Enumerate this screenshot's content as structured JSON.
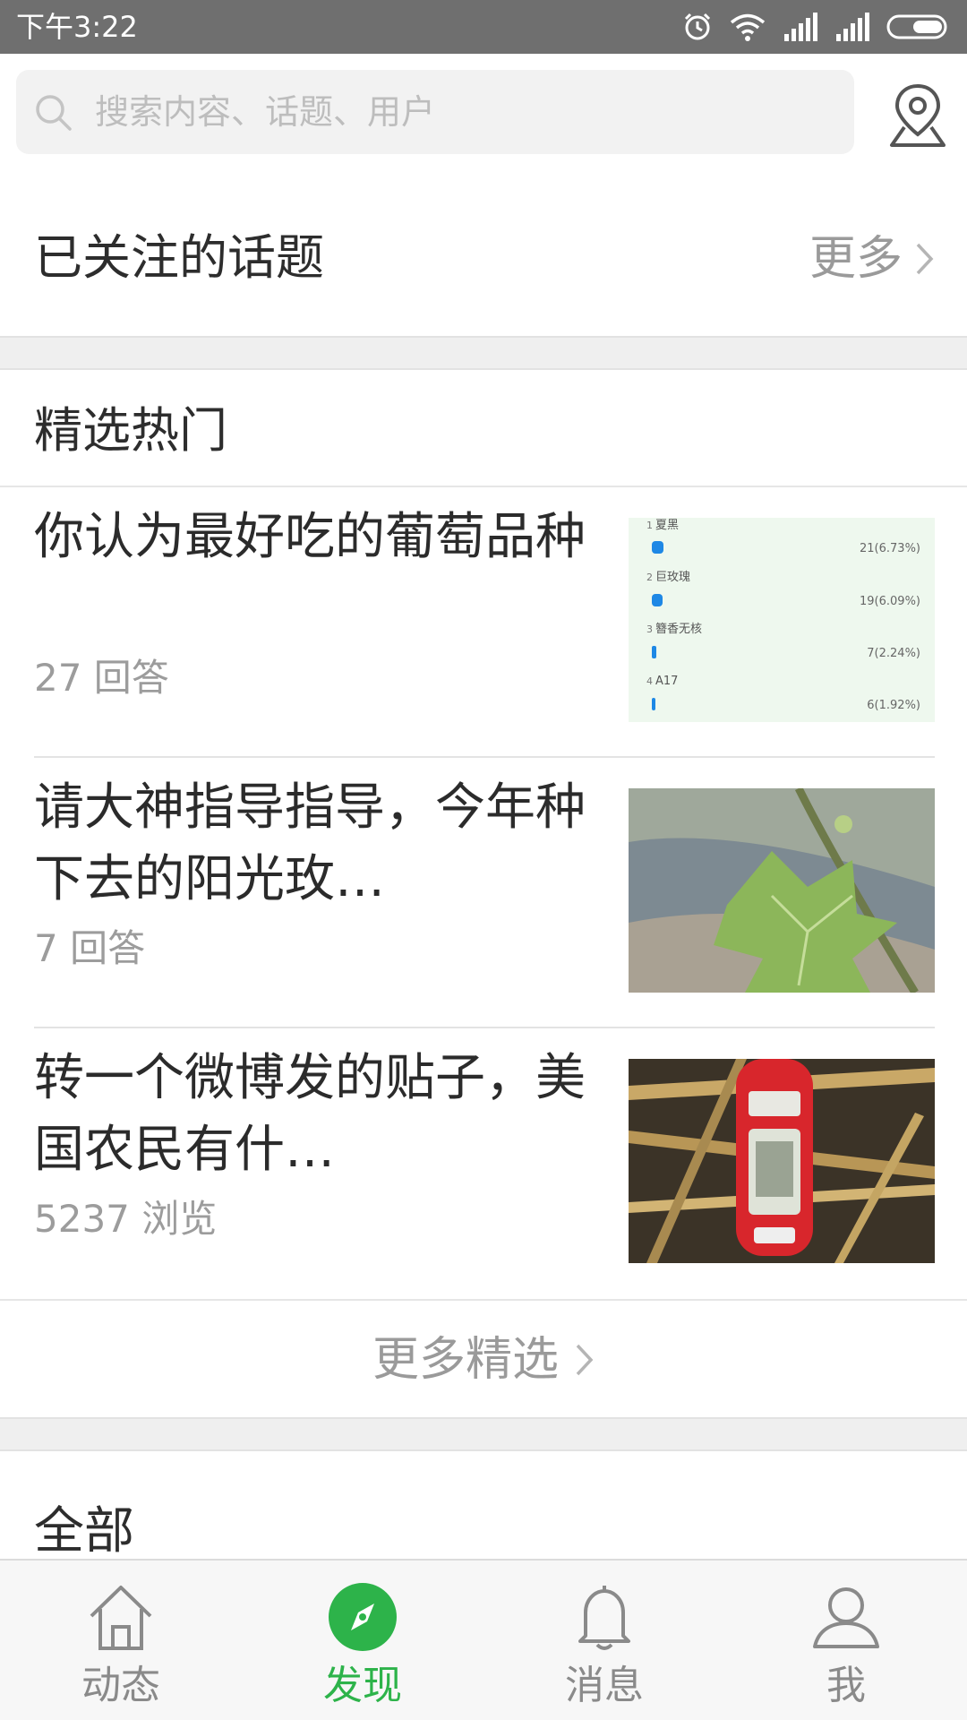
{
  "status_bar": {
    "time": "下午3:22"
  },
  "search": {
    "placeholder": "搜索内容、话题、用户"
  },
  "followed_topics": {
    "title": "已关注的话题",
    "more_label": "更多"
  },
  "picks": {
    "title": "精选热门",
    "posts": [
      {
        "title": "你认为最好吃的葡萄品种",
        "meta": "27 回答",
        "poll": [
          {
            "rank": "1",
            "name": "夏黑",
            "result": "21(6.73%)",
            "percent": 6.73
          },
          {
            "rank": "2",
            "name": "巨玫瑰",
            "result": "19(6.09%)",
            "percent": 6.09
          },
          {
            "rank": "3",
            "name": "簪香无核",
            "result": "7(2.24%)",
            "percent": 2.24
          },
          {
            "rank": "4",
            "name": "A17",
            "result": "6(1.92%)",
            "percent": 1.92
          }
        ]
      },
      {
        "title": "请大神指导指导，今年种下去的阳光玫…",
        "meta": "7 回答"
      },
      {
        "title": "转一个微博发的贴子，美国农民有什…",
        "meta": "5237 浏览"
      }
    ],
    "more_label": "更多精选"
  },
  "all_section": {
    "title": "全部"
  },
  "tab_bar": {
    "tabs": [
      {
        "label": "动态",
        "icon": "home-icon",
        "active": false
      },
      {
        "label": "发现",
        "icon": "compass-icon",
        "active": true
      },
      {
        "label": "消息",
        "icon": "bell-icon",
        "active": false
      },
      {
        "label": "我",
        "icon": "person-icon",
        "active": false
      }
    ]
  },
  "colors": {
    "accent": "#2db34a",
    "status_bar": "#6f6f6f",
    "poll_bar": "#1e88e5"
  }
}
